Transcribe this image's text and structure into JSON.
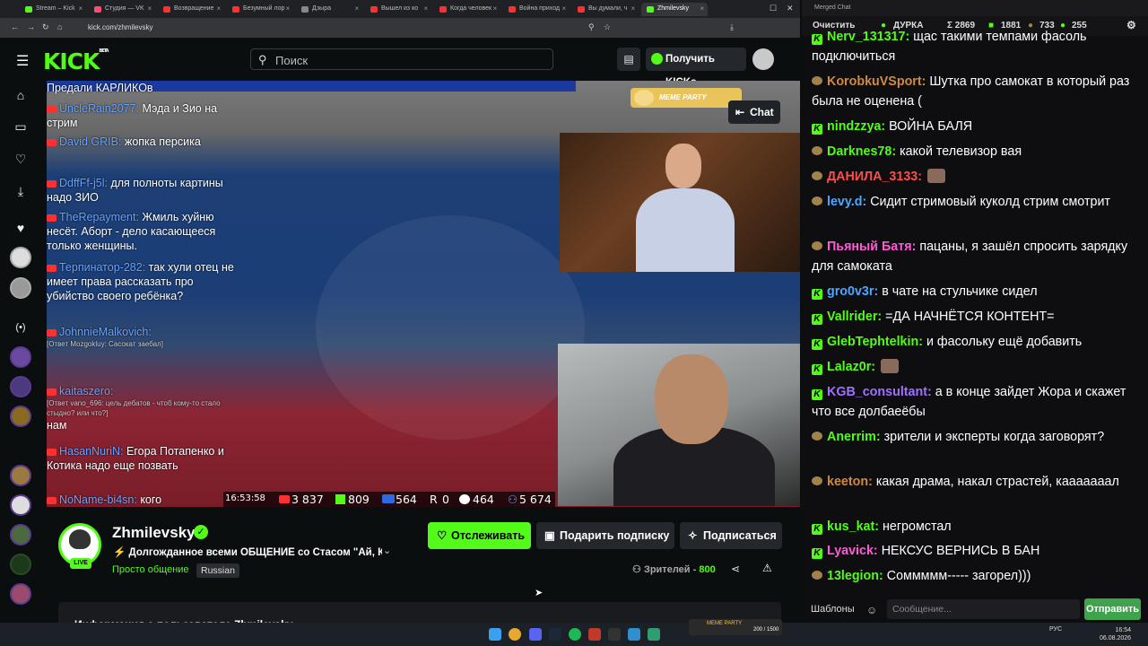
{
  "browser": {
    "tabs": [
      {
        "label": "Stream – Kick",
        "color": "#53fc18",
        "active": false
      },
      {
        "label": "Студия — VK",
        "color": "#ff4d6d",
        "active": false
      },
      {
        "label": "Возвращение",
        "color": "#ff3030",
        "active": false
      },
      {
        "label": "Безумный лор",
        "color": "#ff3030",
        "active": false
      },
      {
        "label": "Дзырa",
        "color": "#888888",
        "active": false
      },
      {
        "label": "Вышел из ко",
        "color": "#ff3030",
        "active": false
      },
      {
        "label": "Когда человек",
        "color": "#ff3030",
        "active": false
      },
      {
        "label": "Война приход",
        "color": "#ff3030",
        "active": false
      },
      {
        "label": "Вы думали, ч",
        "color": "#ff3030",
        "active": false
      },
      {
        "label": "Zhmilevsky",
        "color": "#53fc18",
        "active": true
      }
    ],
    "url": "kick.com/zhmilevsky"
  },
  "header": {
    "logo": "KICK",
    "logo_beta": "BETA",
    "search_placeholder": "Поиск",
    "get_kicks": "Получить KICKs"
  },
  "video": {
    "chat_lines": [
      {
        "user": "",
        "text": "Предали КАРЛИКОв"
      },
      {
        "user": "UncleRain2077:",
        "text": "Мэда и Зио на стрим"
      },
      {
        "user": "David GRIB:",
        "text": "жопка персика"
      },
      {
        "user": "DdffFf-j5l:",
        "text": "для полноты картины надо ЗИО"
      },
      {
        "user": "TheRepayment:",
        "text": "Жмиль хуйню несёт. Аборт - дело касающееся только женщины."
      },
      {
        "user": "Терпинатор-282:",
        "text": "так хули отец не имеет права рассказать про убийство своего ребёнка?"
      },
      {
        "user": "JohnnieMalkovich:",
        "text": "",
        "sub": "[Ответ Mozgokluy: Сасокат заебал]"
      },
      {
        "user": "kaitaszero:",
        "text": "нам",
        "sub": "[Ответ vano_696: цель дебатов - чтоб кому-то стало стыдно? или что?]"
      },
      {
        "user": "HasanNuriN:",
        "text": "Егора Потапенко и Котика надо еще позвать"
      },
      {
        "user": "NoName-bi4sn:",
        "text": "кого"
      }
    ],
    "stats": {
      "time": "16:53:58",
      "youtube": "3 837",
      "kick": "809",
      "vk": "564",
      "r": "0",
      "other": "464",
      "total": "5 674"
    },
    "chat_button": "Chat",
    "meme_party": "MEME PARTY"
  },
  "channel": {
    "name": "Zhmilevsky",
    "live_badge": "LIVE",
    "stream_title": "Долгожданное всеми ОБЩЕНИЕ со Стасом \"Ай, К...",
    "category": "Просто общение",
    "language": "Russian",
    "follow": "Отслеживать",
    "gift": "Подарить подписку",
    "subscribe": "Подписаться",
    "viewers_label": "Зрителей -",
    "viewers_count": "800",
    "about_label": "Информация о пользователе Zhmilevsky"
  },
  "merged_chat": {
    "window_title": "Merged Chat",
    "clear": "Очистить",
    "channel": "ДУРКА",
    "count_total": "Σ 2869",
    "count_kick": "1881",
    "count_tw": "733",
    "count_other": "255",
    "messages": [
      {
        "src": "k",
        "user": "Nerv_131317:",
        "color": "#53fc18",
        "text": "щас такими темпами фасоль подключиться"
      },
      {
        "src": "t",
        "user": "KorobkuVSport:",
        "color": "#d08a40",
        "text": "Шутка про самокат в который раз была не оценена ("
      },
      {
        "src": "k",
        "user": "nindzzya:",
        "color": "#53fc18",
        "text": "ВОЙНА БАЛЯ"
      },
      {
        "src": "t",
        "user": "Darknes78:",
        "color": "#53fc18",
        "text": "какой телевизор вая"
      },
      {
        "src": "t",
        "user": "ДАНИЛА_3133:",
        "color": "#ff4d4d",
        "text": ""
      },
      {
        "src": "t",
        "user": "levy.d:",
        "color": "#4da6ff",
        "text": "Сидит стримовый куколд стрим смотрит"
      },
      {
        "src": "t",
        "user": "Пьяный Батя:",
        "color": "#ff5ad6",
        "text": "пацаны, я зашёл спросить зарядку для самоката"
      },
      {
        "src": "k",
        "user": "gro0v3r:",
        "color": "#4da6ff",
        "text": "в чате на стульчике сидел"
      },
      {
        "src": "k",
        "user": "Vallrider:",
        "color": "#53fc18",
        "text": "=ДА НАЧНЁТСЯ КОНТЕНТ="
      },
      {
        "src": "k",
        "user": "GlebTephtelkin:",
        "color": "#53fc18",
        "text": "и фасольку ещё добавить"
      },
      {
        "src": "k",
        "user": "Lalaz0r:",
        "color": "#53fc18",
        "text": ""
      },
      {
        "src": "k",
        "user": "KGB_consultant:",
        "color": "#a070ff",
        "text": "а в конце зайдет Жора и скажет что все долбаеёбы"
      },
      {
        "src": "t",
        "user": "Anerrim:",
        "color": "#53fc18",
        "text": "зрители и эксперты когда заговорят?"
      },
      {
        "src": "t",
        "user": "keeton:",
        "color": "#d08a40",
        "text": "какая драма, накал страстей, кааааааал"
      },
      {
        "src": "k",
        "user": "kus_kat:",
        "color": "#53fc18",
        "text": "негромстал"
      },
      {
        "src": "k",
        "user": "Lyavick:",
        "color": "#ff5ad6",
        "text": "НЕКСУС ВЕРНИСЬ В БАН"
      },
      {
        "src": "t",
        "user": "13legion:",
        "color": "#53fc18",
        "text": "Соммммм-----  загорел)))"
      }
    ],
    "templates": "Шаблоны",
    "input_placeholder": "Сообщение...",
    "send": "Отправить"
  },
  "overlay_widget": {
    "label": "MEME PARTY",
    "progress": "200 / 1500"
  },
  "taskbar": {
    "lang": "РУС",
    "time": "16:54",
    "date": "06.08.2026"
  }
}
